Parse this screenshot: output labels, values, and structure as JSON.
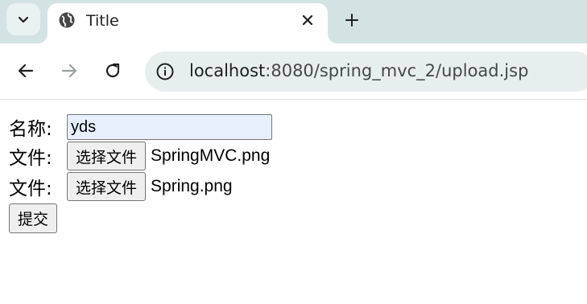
{
  "browser": {
    "tab": {
      "title": "Title",
      "favicon": "globe-icon"
    },
    "toolbar": {
      "url_host": "localhost",
      "url_path": ":8080/spring_mvc_2/upload.jsp"
    }
  },
  "form": {
    "name_label": "名称:",
    "name_value": "yds",
    "file1_label": "文件:",
    "file1_button": "选择文件",
    "file1_name": "SpringMVC.png",
    "file2_label": "文件:",
    "file2_button": "选择文件",
    "file2_name": "Spring.png",
    "submit_label": "提交"
  },
  "colors": {
    "tabstrip_bg": "#d3e3e3",
    "omnibox_bg": "#e6efee",
    "autofill_bg": "#e8f0fe"
  }
}
